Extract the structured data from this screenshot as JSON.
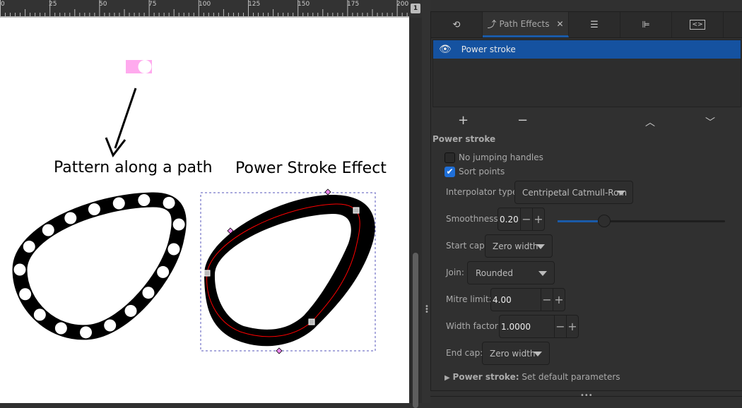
{
  "ruler": {
    "labels": [
      "0",
      "25",
      "50",
      "75",
      "100",
      "125",
      "150",
      "175",
      "200"
    ]
  },
  "canvas": {
    "pattern_label": "Pattern along a path",
    "powerstroke_label": "Power Stroke Effect",
    "pattern_color": "#ffaaee"
  },
  "badge": "1",
  "tabs": [
    {
      "icon": "undo-history-icon"
    },
    {
      "icon": "path-effects-icon",
      "label": "Path Effects",
      "active": true
    },
    {
      "icon": "layers-icon"
    },
    {
      "icon": "align-icon"
    },
    {
      "icon": "xml-editor-icon"
    }
  ],
  "effects_list": [
    {
      "label": "Power stroke",
      "visible": true
    }
  ],
  "list_buttons": {
    "add": "+",
    "remove": "−",
    "up": "^",
    "down": "v"
  },
  "settings": {
    "title": "Power stroke",
    "no_jumping_handles": {
      "label": "No jumping handles",
      "checked": false
    },
    "sort_points": {
      "label": "Sort points",
      "checked": true
    },
    "interpolator_type": {
      "label": "Interpolator type:",
      "value": "Centripetal Catmull-Rom"
    },
    "smoothness": {
      "label": "Smoothness:",
      "value": "0.20",
      "slider_fraction": 0.2
    },
    "start_cap": {
      "label": "Start cap:",
      "value": "Zero width"
    },
    "join": {
      "label": "Join:",
      "value": "Rounded"
    },
    "mitre_limit": {
      "label": "Mitre limit:",
      "value": "4.00"
    },
    "width_factor": {
      "label": "Width factor:",
      "value": "1.0000"
    },
    "end_cap": {
      "label": "End cap:",
      "value": "Zero width"
    },
    "defaults": {
      "bold": "Power stroke:",
      "text": " Set default parameters"
    }
  },
  "colors": {
    "accent": "#1552a0",
    "checkbox": "#1f6fd8",
    "path": "#ff0000"
  }
}
